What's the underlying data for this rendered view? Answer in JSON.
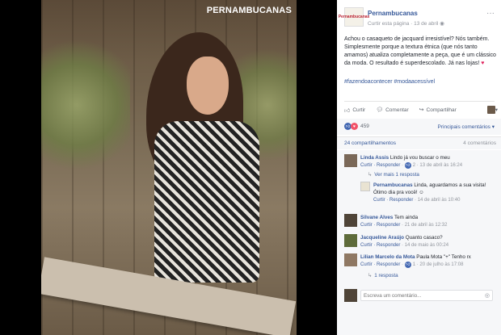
{
  "photo": {
    "brand_watermark": "PERNAMBUCANAS"
  },
  "post": {
    "page_name": "Pernambucanas",
    "page_avatar_text": "Pernambucanas",
    "follow_link": "Curtir esta página",
    "date": "13 de abril",
    "text": "Achou o casaqueto de jacquard irresistível? Nós também. Simplesmente porque a textura étnica (que nós tanto amamos) atualiza completamente a peça, que é um clássico da moda. O resultado é superdescolado. Já nas lojas!",
    "hashtags": "#fazendoacontecer #modaacessível"
  },
  "actions": {
    "like": "Curtir",
    "comment": "Comentar",
    "share": "Compartilhar"
  },
  "stats": {
    "reaction_count": "459",
    "relevant_comments": "Principais comentários",
    "shares": "24 compartilhamentos",
    "comments": "4 comentários"
  },
  "comments": [
    {
      "name": "Linda Assis",
      "text": "Lindo já vou buscar o meu",
      "reply": "Curtir · Responder",
      "likes": "2",
      "time": "13 de abril às 16:24",
      "see_more": "Ver mais 1 resposta",
      "replies": [
        {
          "name": "Pernambucanas",
          "text": "Linda, aguardamos a sua visita! Ótimo dia pra você!",
          "reply": "Curtir · Responder",
          "time": "14 de abril às 10:40"
        }
      ]
    },
    {
      "name": "Silvane Alves",
      "text": "Tem ainda",
      "reply": "Curtir · Responder",
      "time": "21 de abril às 12:32"
    },
    {
      "name": "Jacqueline Araújo",
      "text": "Quanto casaco?",
      "reply": "Curtir · Responder",
      "time": "14 de maio às 00:24"
    },
    {
      "name": "Lilian Marcelo da Mota",
      "text": "Paula Mota \"+\" Tenho rx",
      "reply": "Curtir · Responder",
      "likes": "1",
      "time": "20 de julho às 17:08",
      "see_more": "1 resposta"
    }
  ],
  "composer": {
    "placeholder": "Escreva um comentário..."
  },
  "colors": {
    "link": "#365899",
    "muted": "#90949c",
    "like_blue": "#4267b2",
    "love_red": "#f25268"
  }
}
